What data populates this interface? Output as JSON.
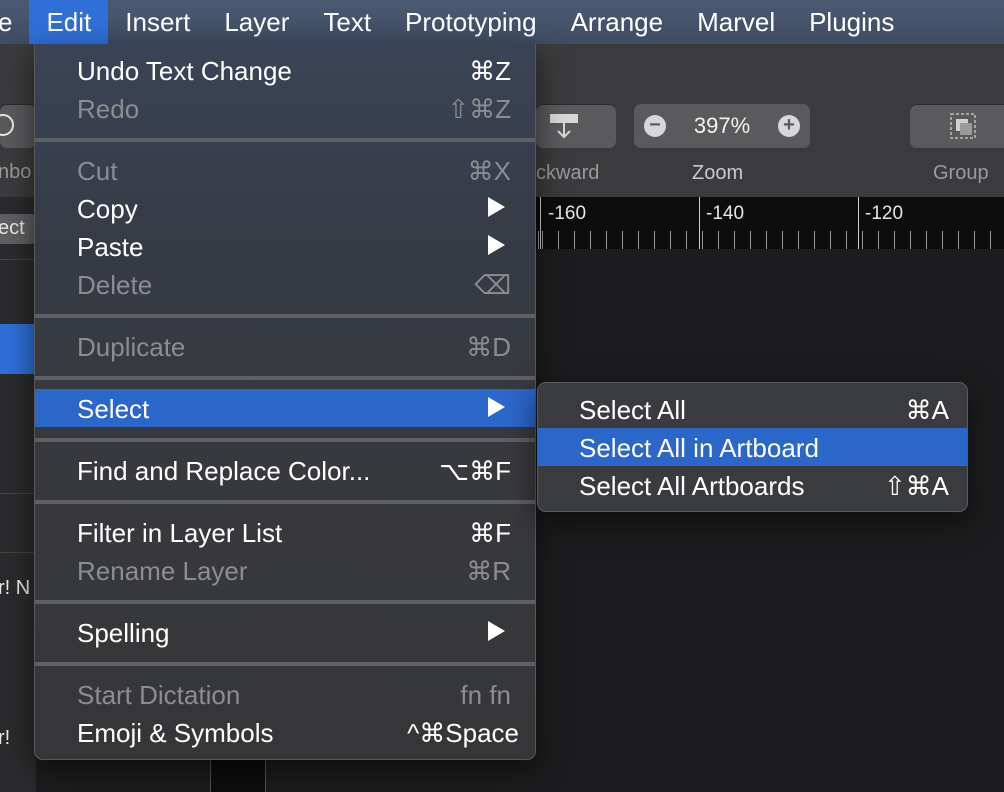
{
  "menubar": {
    "items": [
      {
        "label": "e"
      },
      {
        "label": "Edit"
      },
      {
        "label": "Insert"
      },
      {
        "label": "Layer"
      },
      {
        "label": "Text"
      },
      {
        "label": "Prototyping"
      },
      {
        "label": "Arrange"
      },
      {
        "label": "Marvel"
      },
      {
        "label": "Plugins"
      }
    ],
    "active": "Edit"
  },
  "toolbar": {
    "backward_label": "ckward",
    "zoom_label": "Zoom",
    "zoom_value": "397%",
    "zoom_out": "−",
    "zoom_in": "+",
    "group_label": "Group",
    "symbol_label": "nbo",
    "icons": [
      "backward-icon",
      "group-icon",
      "insert-dropdown-icon"
    ]
  },
  "ruler": {
    "marks": [
      "-160",
      "-140",
      "-120"
    ]
  },
  "left_panel": {
    "tab_label": "ect",
    "text_1": "r! N",
    "text_2": "r!"
  },
  "edit_menu": {
    "items": [
      {
        "label": "Undo Text Change",
        "shortcut": "⌘Z",
        "enabled": true
      },
      {
        "label": "Redo",
        "shortcut": "⇧⌘Z",
        "enabled": false
      },
      {
        "label": "Cut",
        "shortcut": "⌘X",
        "enabled": false
      },
      {
        "label": "Copy",
        "submenu": true,
        "enabled": true
      },
      {
        "label": "Paste",
        "submenu": true,
        "enabled": true
      },
      {
        "label": "Delete",
        "shortcut": "⌫",
        "enabled": false
      },
      {
        "label": "Duplicate",
        "shortcut": "⌘D",
        "enabled": false
      },
      {
        "label": "Select",
        "submenu": true,
        "enabled": true,
        "highlighted": true
      },
      {
        "label": "Find and Replace Color...",
        "shortcut": "⌥⌘F",
        "enabled": true
      },
      {
        "label": "Filter in Layer List",
        "shortcut": "⌘F",
        "enabled": true
      },
      {
        "label": "Rename Layer",
        "shortcut": "⌘R",
        "enabled": false
      },
      {
        "label": "Spelling",
        "submenu": true,
        "enabled": true
      },
      {
        "label": "Start Dictation",
        "shortcut": "fn fn",
        "enabled": false
      },
      {
        "label": "Emoji & Symbols",
        "shortcut": "^⌘Space",
        "enabled": true
      }
    ]
  },
  "select_submenu": {
    "items": [
      {
        "label": "Select All",
        "shortcut": "⌘A"
      },
      {
        "label": "Select All in Artboard",
        "shortcut": "",
        "highlighted": true
      },
      {
        "label": "Select All Artboards",
        "shortcut": "⇧⌘A"
      }
    ]
  },
  "colors": {
    "menubar": "#45536b",
    "highlight": "#2b66c9",
    "menu_bg": "#38393d",
    "disabled_text": "#8b8d92",
    "canvas": "#1c1c1e"
  }
}
